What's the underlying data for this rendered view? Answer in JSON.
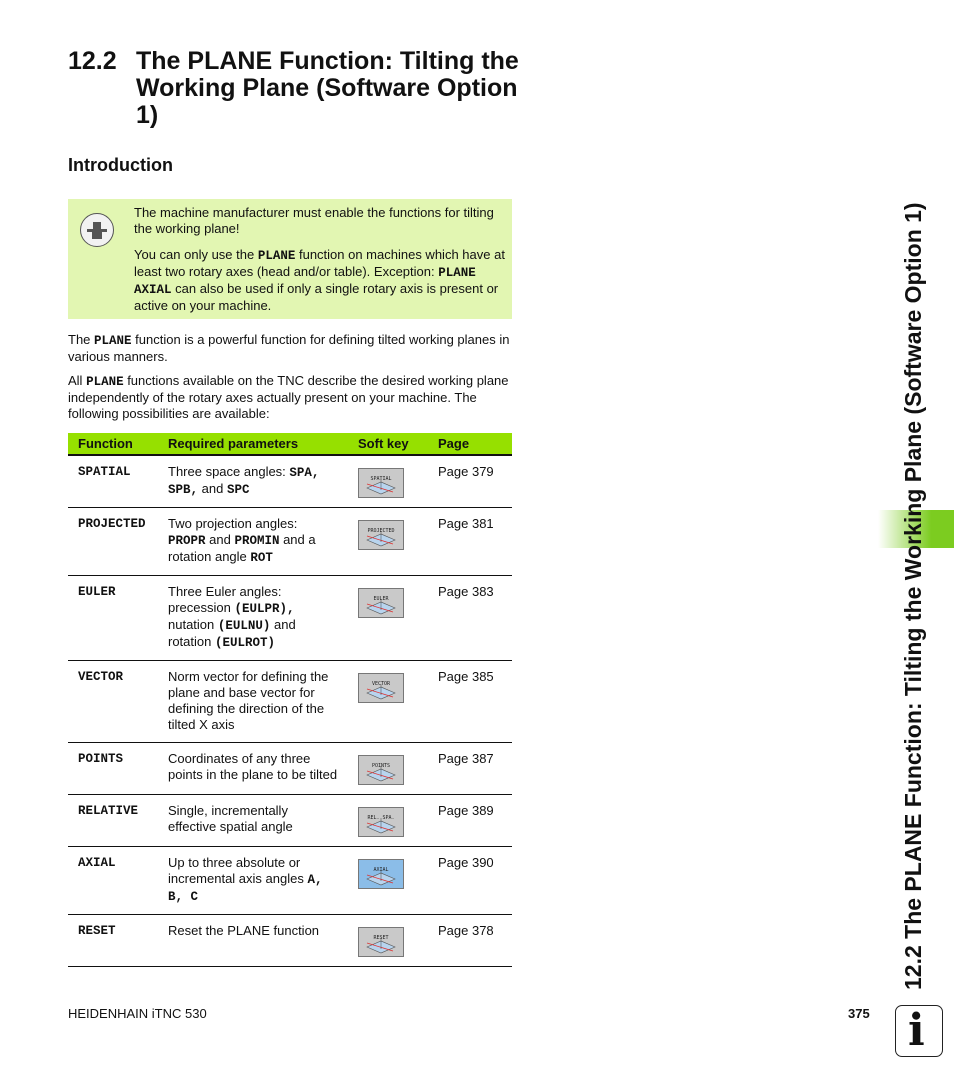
{
  "heading": {
    "number": "12.2",
    "title": "The PLANE Function: Tilting the Working Plane (Software Option 1)"
  },
  "subheading": "Introduction",
  "note": {
    "icon": "machine-manufacturer-icon",
    "p1": "The machine manufacturer must enable the functions for tilting the working plane!",
    "p2_a": "You can only use the ",
    "p2_code1": "PLANE",
    "p2_b": " function on machines which have at least two rotary axes (head and/or table). Exception: ",
    "p2_code2": "PLANE AXIAL",
    "p2_c": " can also be used if only a single rotary axis is present or active on your machine."
  },
  "para1": {
    "a": "The ",
    "code": "PLANE",
    "b": " function is a powerful function for defining tilted working planes in various manners."
  },
  "para2": {
    "a": "All ",
    "code": "PLANE",
    "b": " functions available on the TNC describe the desired working plane independently of the rotary axes actually present on your machine. The following possibilities are available:"
  },
  "table": {
    "headers": [
      "Function",
      "Required parameters",
      "Soft key",
      "Page"
    ],
    "rows": [
      {
        "fn": "SPATIAL",
        "req_html": "Three space angles: <b class=\"mono\">SPA,</b> <b class=\"mono\">SPB,</b> and <b class=\"mono\">SPC</b>",
        "softkey": "SPATIAL",
        "page": "Page 379"
      },
      {
        "fn": "PROJECTED",
        "req_html": "Two projection angles: <b class=\"mono\">PROPR</b> and <b class=\"mono\">PROMIN</b> and a rotation angle <b class=\"mono\">ROT</b>",
        "softkey": "PROJECTED",
        "page": "Page 381"
      },
      {
        "fn": "EULER",
        "req_html": "Three Euler angles: precession <b class=\"mono\">(EULPR),</b> nutation <b class=\"mono\">(EULNU)</b> and rotation <b class=\"mono\">(EULROT)</b>",
        "softkey": "EULER",
        "page": "Page 383"
      },
      {
        "fn": "VECTOR",
        "req_html": "Norm vector for defining the plane and base vector for defining the direction of the tilted X axis",
        "softkey": "VECTOR",
        "page": "Page 385"
      },
      {
        "fn": "POINTS",
        "req_html": "Coordinates of any three points in the plane to be tilted",
        "softkey": "POINTS",
        "page": "Page 387"
      },
      {
        "fn": "RELATIVE",
        "req_html": "Single, incrementally effective spatial angle",
        "softkey": "REL. SPA.",
        "page": "Page 389"
      },
      {
        "fn": "AXIAL",
        "req_html": "Up to three absolute or incremental axis angles <b class=\"mono\">A, B, C</b>",
        "softkey": "AXIAL",
        "page": "Page 390",
        "blue": true
      },
      {
        "fn": "RESET",
        "req_html": "Reset the PLANE function",
        "softkey": "RESET",
        "page": "Page 378"
      }
    ]
  },
  "sidebar_title": "12.2 The PLANE Function: Tilting the Working Plane (Software Option 1)",
  "footer": {
    "left": "HEIDENHAIN iTNC 530",
    "page": "375",
    "icon": "info-icon"
  },
  "colors": {
    "note_bg": "#e2f6b2",
    "table_header": "#96e000",
    "tab": "#7ccc20"
  }
}
